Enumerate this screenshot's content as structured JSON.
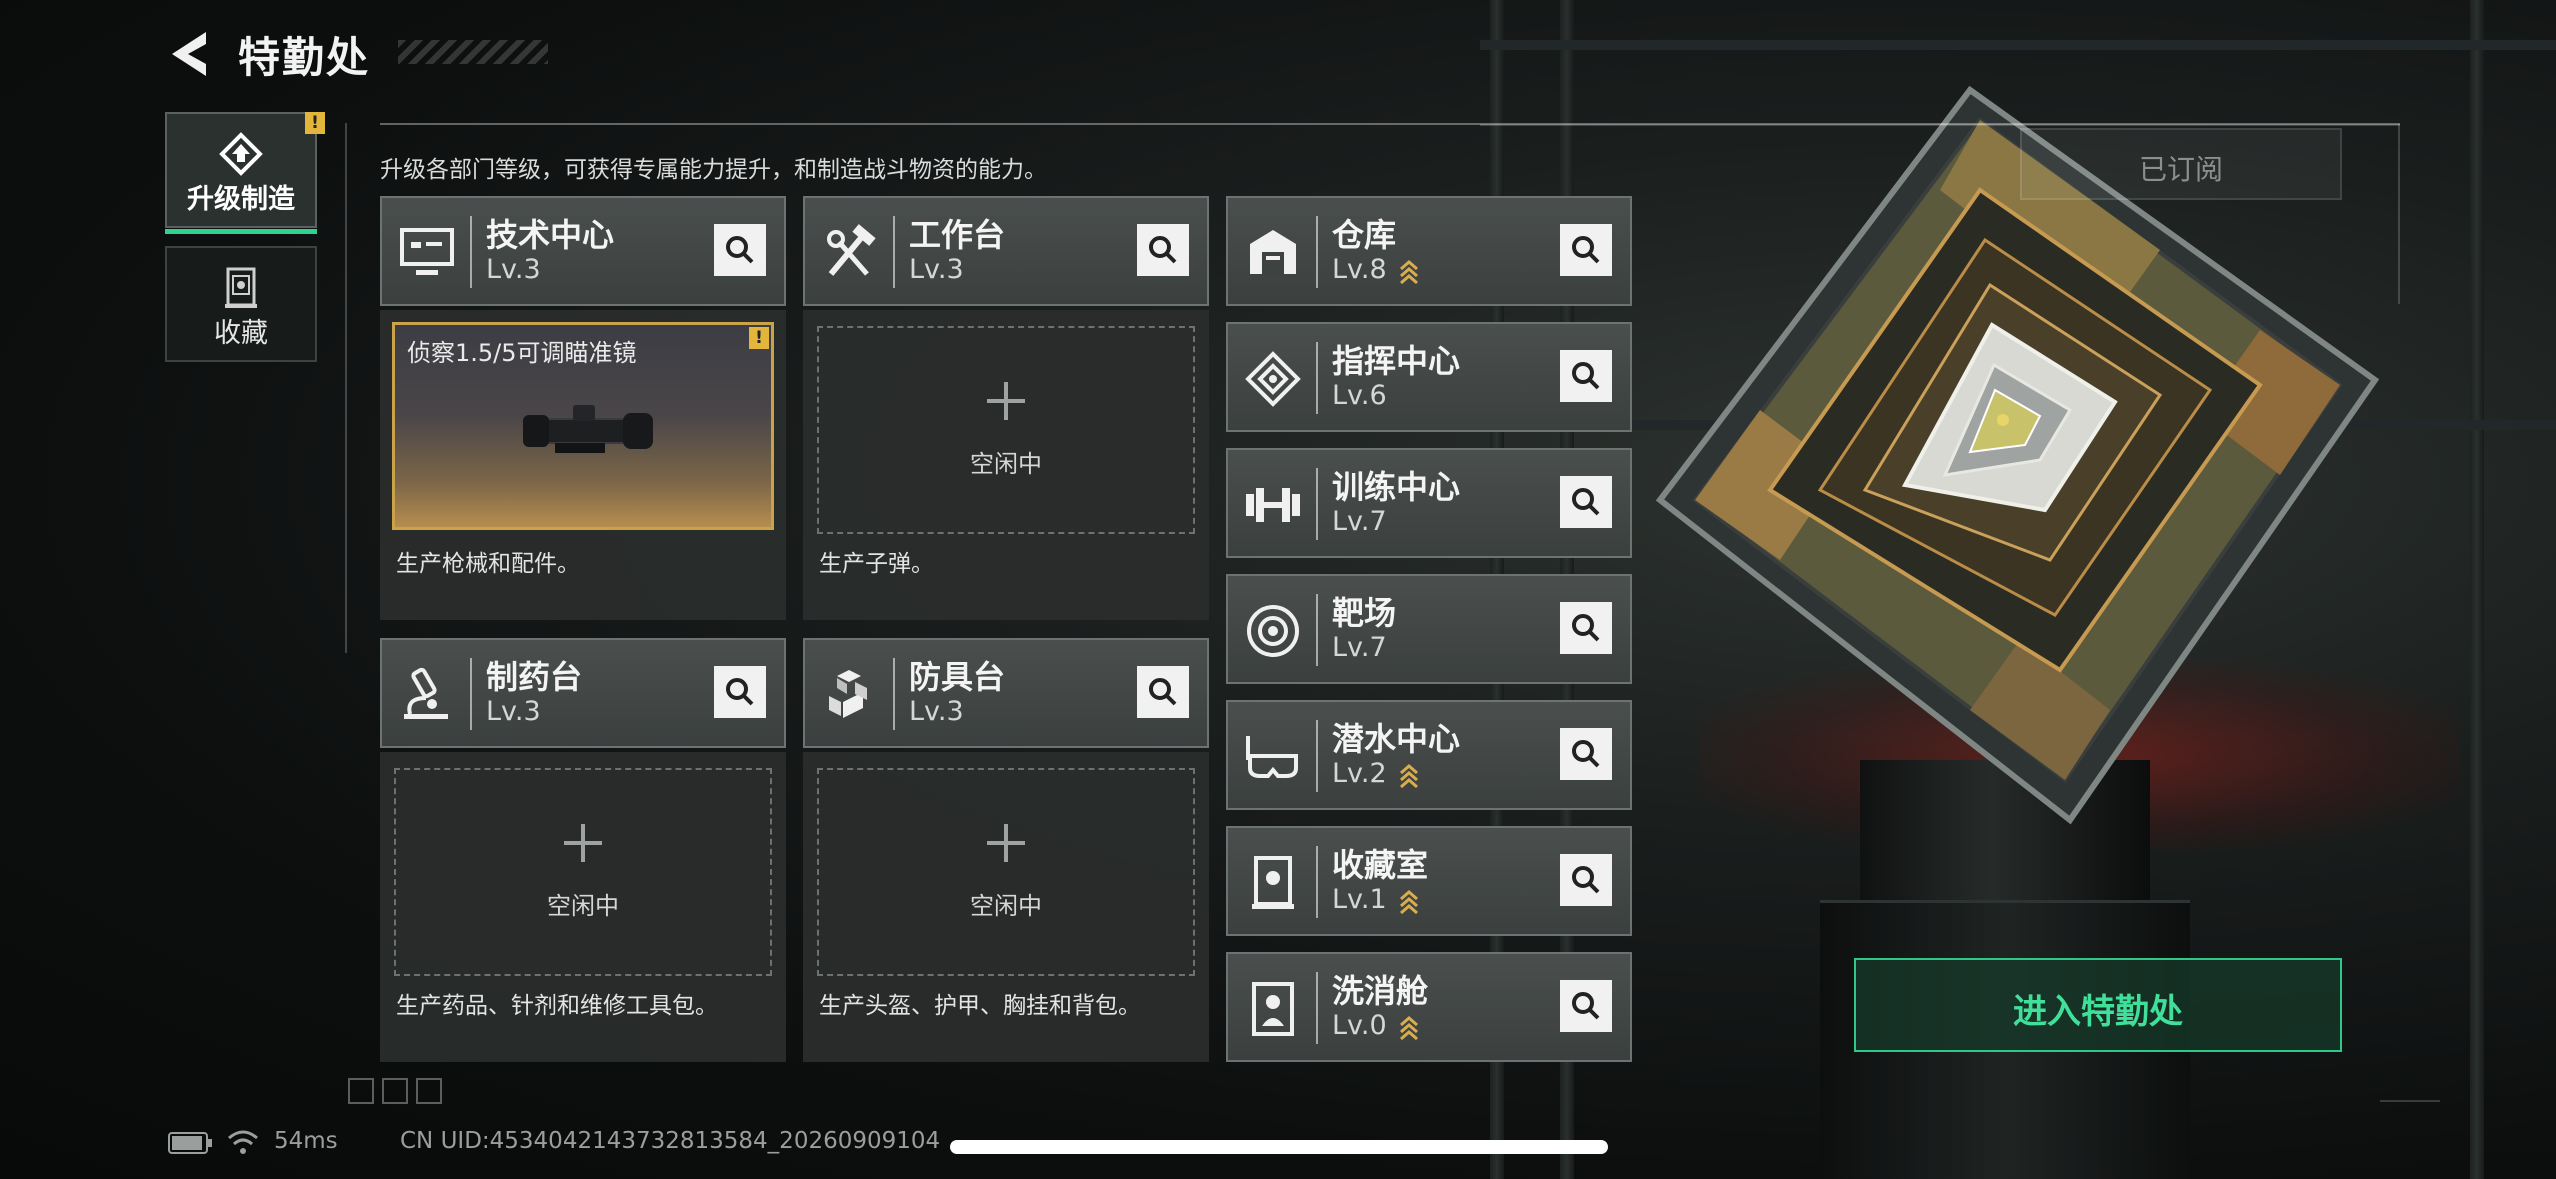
{
  "header": {
    "title": "特勤处",
    "subtitle": "升级各部门等级，可获得专属能力提升，和制造战斗物资的能力。"
  },
  "nav": {
    "items": [
      {
        "label": "升级制造",
        "icon": "upgrade-build-icon",
        "active": true,
        "badge": "!"
      },
      {
        "label": "收藏",
        "icon": "collection-icon",
        "active": false
      }
    ]
  },
  "workshops": [
    {
      "name": "技术中心",
      "level": "Lv.3",
      "icon": "monitor-icon",
      "slot": {
        "type": "producing",
        "item": "侦察1.5/5可调瞄准镜",
        "badge": "!"
      },
      "desc": "生产枪械和配件。"
    },
    {
      "name": "工作台",
      "level": "Lv.3",
      "icon": "tools-icon",
      "slot": {
        "type": "idle",
        "label": "空闲中"
      },
      "desc": "生产子弹。"
    },
    {
      "name": "制药台",
      "level": "Lv.3",
      "icon": "microscope-icon",
      "slot": {
        "type": "idle",
        "label": "空闲中"
      },
      "desc": "生产药品、针剂和维修工具包。"
    },
    {
      "name": "防具台",
      "level": "Lv.3",
      "icon": "cubes-icon",
      "slot": {
        "type": "idle",
        "label": "空闲中"
      },
      "desc": "生产头盔、护甲、胸挂和背包。"
    }
  ],
  "facilities": [
    {
      "name": "仓库",
      "level": "Lv.8",
      "icon": "warehouse-icon",
      "upgradable": true
    },
    {
      "name": "指挥中心",
      "level": "Lv.6",
      "icon": "command-icon",
      "upgradable": false
    },
    {
      "name": "训练中心",
      "level": "Lv.7",
      "icon": "dumbbell-icon",
      "upgradable": false
    },
    {
      "name": "靶场",
      "level": "Lv.7",
      "icon": "target-icon",
      "upgradable": false
    },
    {
      "name": "潜水中心",
      "level": "Lv.2",
      "icon": "diving-mask-icon",
      "upgradable": true
    },
    {
      "name": "收藏室",
      "level": "Lv.1",
      "icon": "display-case-icon",
      "upgradable": true
    },
    {
      "name": "洗消舱",
      "level": "Lv.0",
      "icon": "decontamination-icon",
      "upgradable": true
    }
  ],
  "actions": {
    "subscribed": "已订阅",
    "enter": "进入特勤处"
  },
  "status": {
    "ping": "54ms",
    "uid": "CN UID:4534042143732813584_20260909104"
  },
  "colors": {
    "accent_green": "#2fd38d",
    "warning_yellow": "#e3b53b",
    "production_gold": "#c9a24a"
  }
}
